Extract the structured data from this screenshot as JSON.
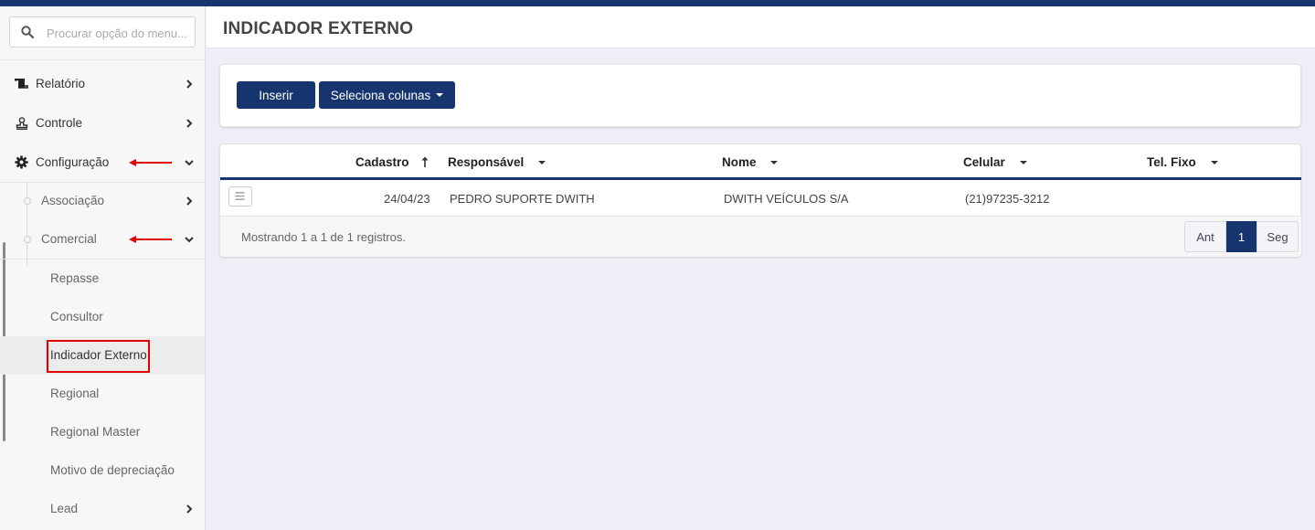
{
  "colors": {
    "primary": "#16356f",
    "annotation": "#e00000"
  },
  "search": {
    "placeholder": "Procurar opção do menu..."
  },
  "sidebar": {
    "items": [
      {
        "label": "Relatório",
        "icon": "scroll-icon"
      },
      {
        "label": "Controle",
        "icon": "stamp-icon"
      },
      {
        "label": "Configuração",
        "icon": "gear-icon"
      }
    ],
    "subitems": [
      {
        "label": "Associação"
      },
      {
        "label": "Comercial"
      }
    ],
    "leaves": [
      {
        "label": "Repasse"
      },
      {
        "label": "Consultor"
      },
      {
        "label": "Indicador Externo",
        "active": true
      },
      {
        "label": "Regional"
      },
      {
        "label": "Regional Master"
      },
      {
        "label": "Motivo de depreciação"
      },
      {
        "label": "Lead"
      }
    ]
  },
  "header": {
    "title": "INDICADOR EXTERNO"
  },
  "toolbar": {
    "insert_label": "Inserir",
    "columns_label": "Seleciona colunas"
  },
  "table": {
    "columns": [
      {
        "label": "Cadastro",
        "sort": "asc"
      },
      {
        "label": "Responsável"
      },
      {
        "label": "Nome"
      },
      {
        "label": "Celular"
      },
      {
        "label": "Tel. Fixo"
      }
    ],
    "rows": [
      {
        "cadastro": "24/04/23",
        "responsavel": "PEDRO SUPORTE DWITH",
        "nome": "DWITH VEÍCULOS S/A",
        "celular": "(21)97235-3212",
        "tel_fixo": ""
      }
    ],
    "info": "Mostrando 1 a 1 de 1 registros.",
    "pagination": {
      "prev": "Ant",
      "current": "1",
      "next": "Seg"
    }
  }
}
